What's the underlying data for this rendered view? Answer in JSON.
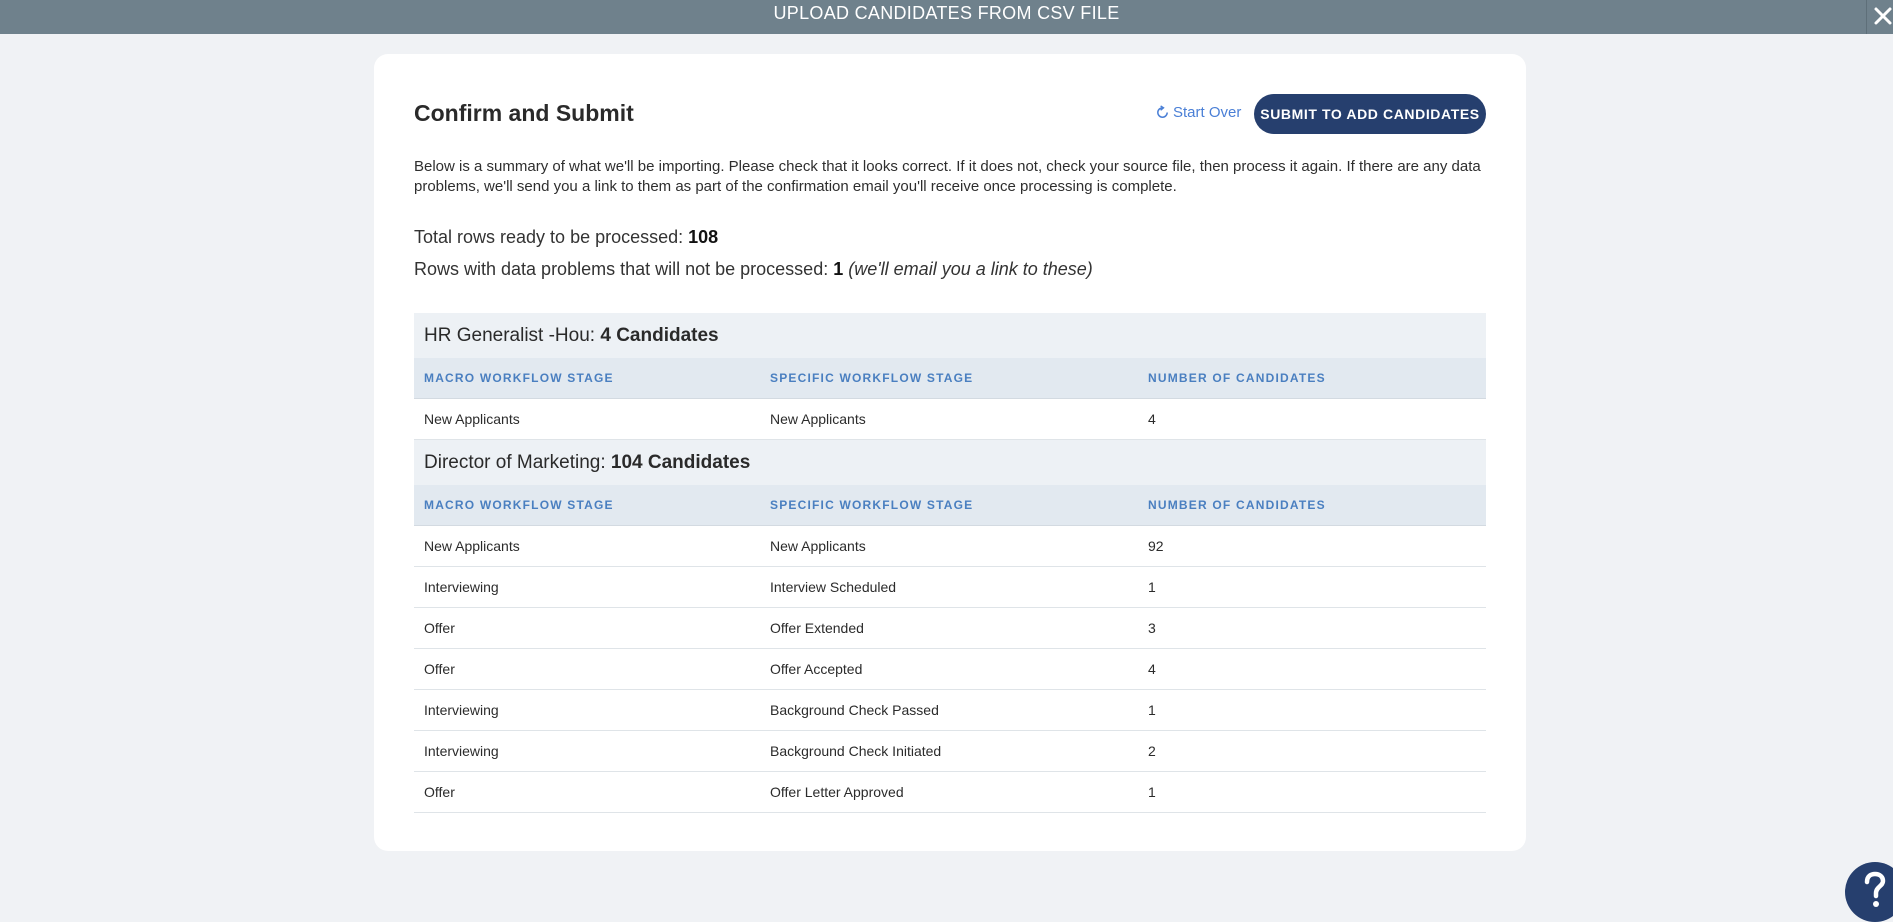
{
  "window": {
    "title": "UPLOAD CANDIDATES FROM CSV FILE"
  },
  "header": {
    "title": "Confirm and Submit",
    "start_over_label": "Start Over",
    "submit_label": "SUBMIT TO ADD CANDIDATES"
  },
  "intro": "Below is a summary of what we'll be importing. Please check that it looks correct. If it does not, check your source file, then process it again. If there are any data problems, we'll send you a link to them as part of the confirmation email you'll receive once processing is complete.",
  "stats": {
    "total_label": "Total rows ready to be processed: ",
    "total_value": "108",
    "problems_label": "Rows with data problems that will not be processed: ",
    "problems_value": "1",
    "problems_note": "(we'll email you a link to these)"
  },
  "columns": {
    "macro": "MACRO WORKFLOW STAGE",
    "specific": "SPECIFIC WORKFLOW STAGE",
    "count": "NUMBER OF CANDIDATES"
  },
  "jobs": [
    {
      "name": "HR Generalist -Hou: ",
      "count_label": "4 Candidates",
      "rows": [
        {
          "macro": "New Applicants",
          "specific": "New Applicants",
          "count": "4"
        }
      ]
    },
    {
      "name": "Director of Marketing: ",
      "count_label": "104 Candidates",
      "rows": [
        {
          "macro": "New Applicants",
          "specific": "New Applicants",
          "count": "92"
        },
        {
          "macro": "Interviewing",
          "specific": "Interview Scheduled",
          "count": "1"
        },
        {
          "macro": "Offer",
          "specific": "Offer Extended",
          "count": "3"
        },
        {
          "macro": "Offer",
          "specific": "Offer Accepted",
          "count": "4"
        },
        {
          "macro": "Interviewing",
          "specific": "Background Check Passed",
          "count": "1"
        },
        {
          "macro": "Interviewing",
          "specific": "Background Check Initiated",
          "count": "2"
        },
        {
          "macro": "Offer",
          "specific": "Offer Letter Approved",
          "count": "1"
        }
      ]
    }
  ],
  "icons": {
    "close": "close-icon",
    "start_over": "refresh-icon",
    "help": "question-icon"
  },
  "colors": {
    "topbar": "#6f818c",
    "primary": "#263f6e",
    "link": "#4a7fd6",
    "column_header_text": "#4a7fc0"
  }
}
